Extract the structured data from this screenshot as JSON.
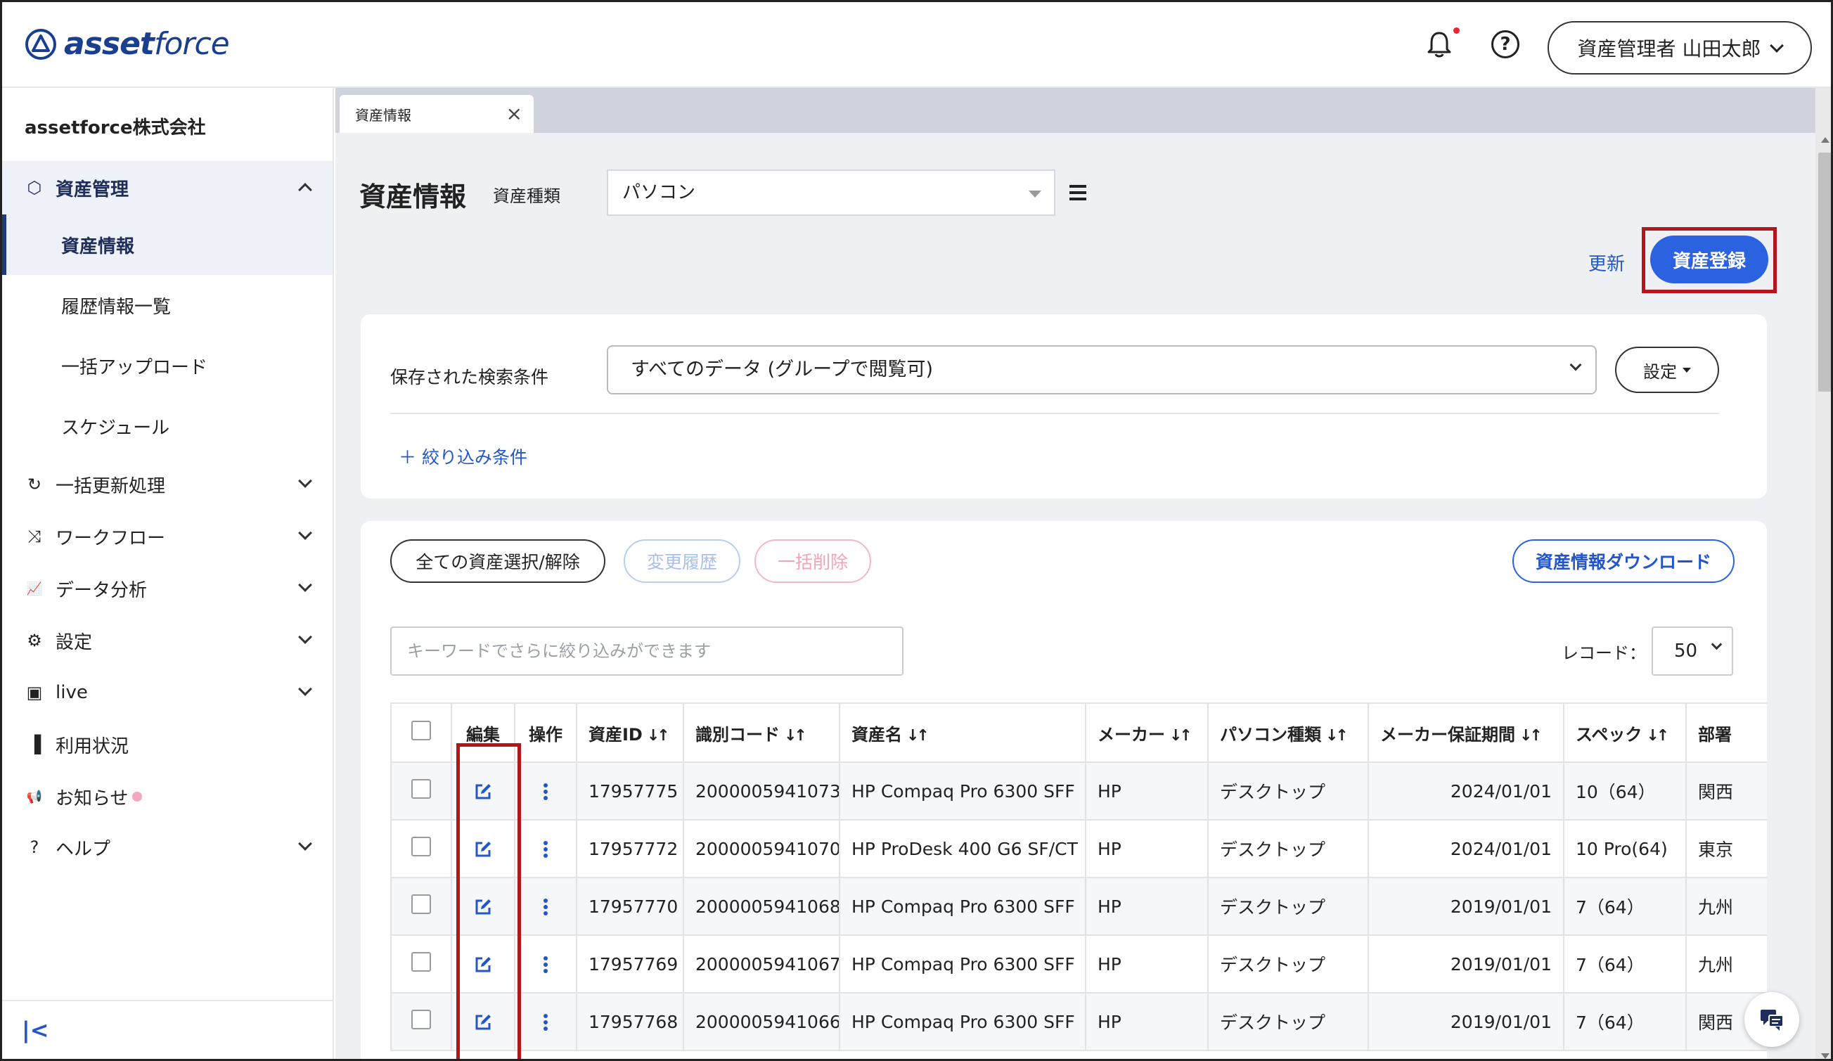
{
  "header": {
    "logo_text_bold": "asset",
    "logo_text_light": "force",
    "user_label": "資産管理者 山田太郎"
  },
  "sidebar": {
    "company": "assetforce株式会社",
    "asset_section": "資産管理",
    "sub_items": [
      "資産情報",
      "履歴情報一覧",
      "一括アップロード",
      "スケジュール"
    ],
    "sections": [
      {
        "icon": "↻",
        "label": "一括更新処理",
        "expandable": true
      },
      {
        "icon": "⤨",
        "label": "ワークフロー",
        "expandable": true
      },
      {
        "icon": "📈",
        "label": "データ分析",
        "expandable": true
      },
      {
        "icon": "⚙",
        "label": "設定",
        "expandable": true
      },
      {
        "icon": "▣",
        "label": "live",
        "expandable": true
      },
      {
        "icon": "▐",
        "label": "利用状況",
        "expandable": false
      },
      {
        "icon": "📢",
        "label": "お知らせ",
        "expandable": false
      },
      {
        "icon": "?",
        "label": "ヘルプ",
        "expandable": true
      }
    ],
    "collapse_icon": "|<"
  },
  "tab": {
    "label": "資産情報",
    "close": "×"
  },
  "page": {
    "title": "資産情報",
    "type_label": "資産種類",
    "type_value": "パソコン",
    "update_link": "更新",
    "register_button": "資産登録"
  },
  "search": {
    "saved_label": "保存された検索条件",
    "saved_value": "すべてのデータ (グループで閲覧可)",
    "settings_button": "設定",
    "filter_link": "＋ 絞り込み条件"
  },
  "toolbar": {
    "select_all": "全ての資産選択/解除",
    "change_history": "変更履歴",
    "bulk_delete": "一括削除",
    "download": "資産情報ダウンロード",
    "keyword_placeholder": "キーワードでさらに絞り込みができます",
    "record_label": "レコード：",
    "record_value": "50"
  },
  "table": {
    "headers": [
      "編集",
      "操作",
      "資産ID",
      "識別コード",
      "資産名",
      "メーカー",
      "パソコン種類",
      "メーカー保証期間",
      "スペック",
      "部署"
    ],
    "rows": [
      [
        "17957775",
        "2000005941073",
        "HP Compaq Pro 6300 SFF",
        "HP",
        "デスクトップ",
        "2024/01/01",
        "10（64）",
        "関西"
      ],
      [
        "17957772",
        "2000005941070",
        "HP ProDesk 400 G6 SF/CT",
        "HP",
        "デスクトップ",
        "2024/01/01",
        "10 Pro(64)",
        "東京"
      ],
      [
        "17957770",
        "2000005941068",
        "HP Compaq Pro 6300 SFF",
        "HP",
        "デスクトップ",
        "2019/01/01",
        "7（64）",
        "九州"
      ],
      [
        "17957769",
        "2000005941067",
        "HP Compaq Pro 6300 SFF",
        "HP",
        "デスクトップ",
        "2019/01/01",
        "7（64）",
        "九州"
      ],
      [
        "17957768",
        "2000005941066",
        "HP Compaq Pro 6300 SFF",
        "HP",
        "デスクトップ",
        "2019/01/01",
        "7（64）",
        "関西"
      ]
    ]
  },
  "colors": {
    "primary": "#2a62e0",
    "highlight_box": "#b3151b",
    "sidebar_active_bg": "#eef1f7"
  }
}
